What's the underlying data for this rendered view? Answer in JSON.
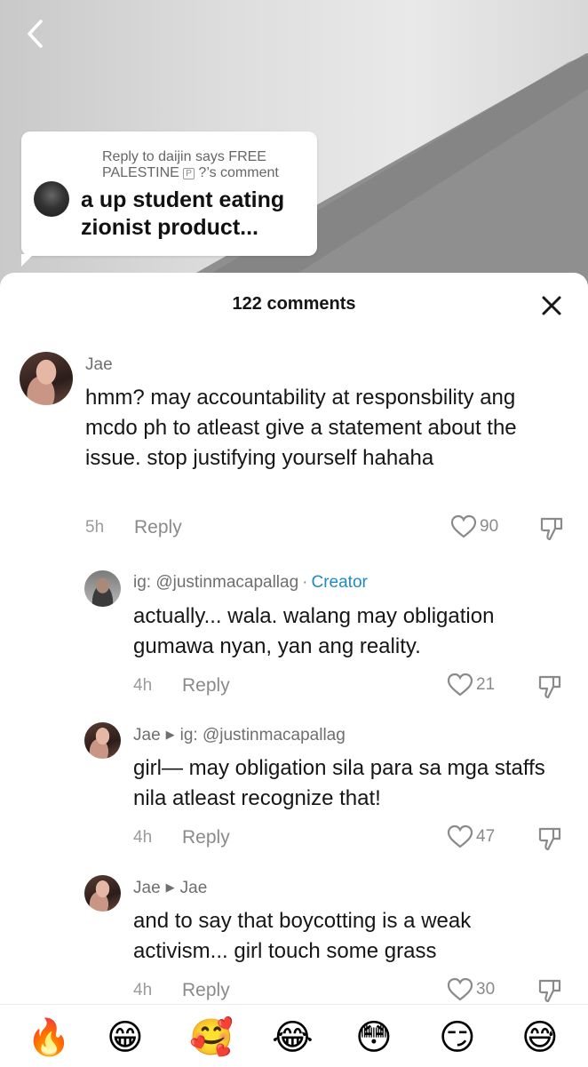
{
  "reply_card": {
    "header": "Reply to daijin says FREE PALESTINE",
    "badge": "P",
    "header_suffix": " ?’s comment",
    "text": "a up student eating zionist product..."
  },
  "sheet": {
    "title": "122 comments"
  },
  "comments": [
    {
      "username": "Jae",
      "text": "hmm? may accountability at responsbility ang mcdo ph to atleast give a statement about the issue. stop justifying yourself hahaha",
      "time": "5h",
      "reply_label": "Reply",
      "likes": "90"
    },
    {
      "username": "ig: @justinmacapallag",
      "creator_label": "Creator",
      "text": "actually... wala. walang may obligation gumawa nyan, yan ang reality.",
      "time": "4h",
      "reply_label": "Reply",
      "likes": "21"
    },
    {
      "username": "Jae",
      "reply_to": "ig: @justinmacapallag",
      "text": "girl— may obligation sila para sa mga staffs nila atleast recognize that!",
      "time": "4h",
      "reply_label": "Reply",
      "likes": "47"
    },
    {
      "username": "Jae",
      "reply_to": "Jae",
      "text": "and to say that boycotting is a weak activism... girl touch some grass",
      "time": "4h",
      "reply_label": "Reply",
      "likes": "30"
    }
  ],
  "emoji_bar": [
    "🔥",
    "😁",
    "🥰",
    "😂",
    "😳",
    "😏",
    "😅"
  ],
  "icons": {
    "back": "chevron-left-icon",
    "close": "close-icon",
    "like": "heart-outline-icon",
    "dislike": "thumbs-down-icon"
  },
  "colors": {
    "creator": "#1f8ac0",
    "muted": "#8a8a8a"
  }
}
